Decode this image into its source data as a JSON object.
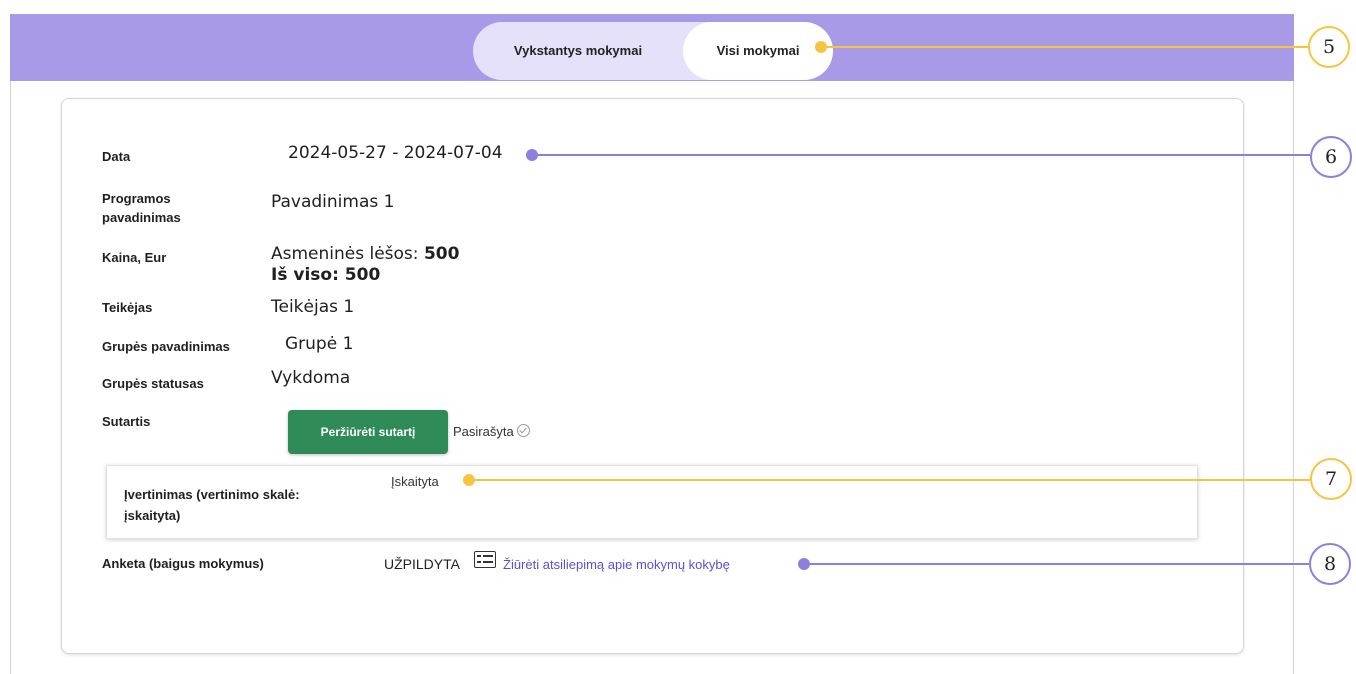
{
  "tabs": {
    "ongoing": "Vykstantys mokymai",
    "all": "Visi mokymai"
  },
  "details": {
    "date_label": "Data",
    "date_value": "2024-05-27 - 2024-07-04",
    "program_label_1": "Programos",
    "program_label_2": "pavadinimas",
    "program_value": "Pavadinimas 1",
    "price_label": "Kaina, Eur",
    "price_personal_prefix": "Asmeninės lėšos: ",
    "price_personal_value": "500",
    "price_total": "Iš viso: 500",
    "provider_label": "Teikėjas",
    "provider_value": "Teikėjas 1",
    "group_name_label": "Grupės pavadinimas",
    "group_name_value": "Grupė 1",
    "group_status_label": "Grupės statusas",
    "group_status_value": "Vykdoma",
    "contract_label": "Sutartis",
    "contract_button": "Peržiūrėti sutartį",
    "contract_status": "Pasirašyta"
  },
  "evaluation": {
    "label_1": "Įvertinimas (vertinimo skalė:",
    "label_2": "įskaityta)",
    "value": "Įskaityta"
  },
  "survey": {
    "label": "Anketa (baigus mokymus)",
    "status": "UŽPILDYTA",
    "link": "Žiūrėti atsiliepimą apie mokymų kokybę"
  },
  "callouts": [
    "5",
    "6",
    "7",
    "8"
  ],
  "colors": {
    "header": "#a89ae6",
    "button_green": "#2e8b57",
    "link": "#5a50d6",
    "callout_yellow": "#f5c542",
    "callout_purple": "#8b80e0"
  }
}
